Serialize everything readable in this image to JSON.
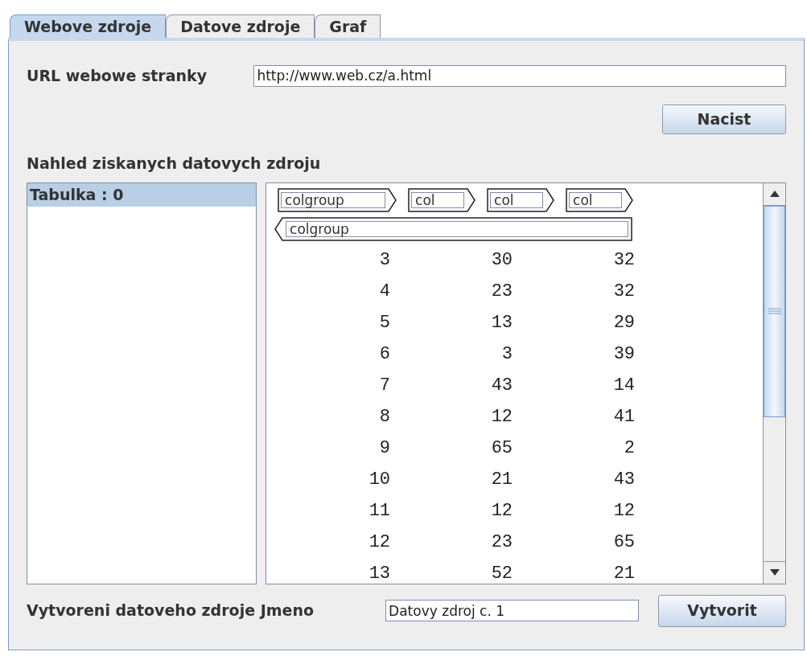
{
  "tabs": [
    {
      "label": "Webove zdroje",
      "selected": true
    },
    {
      "label": "Datove zdroje",
      "selected": false
    },
    {
      "label": "Graf",
      "selected": false
    }
  ],
  "url": {
    "label": "URL webowe stranky",
    "value": "http://www.web.cz/a.html"
  },
  "load_button": "Nacist",
  "preview_heading": "Nahled ziskanych datovych zdroju",
  "tables": [
    {
      "label": "Tabulka : 0",
      "selected": true
    }
  ],
  "tags_row": [
    {
      "label": "colgroup",
      "kind": "open"
    },
    {
      "label": "col",
      "kind": "open"
    },
    {
      "label": "col",
      "kind": "open"
    },
    {
      "label": "col",
      "kind": "open"
    }
  ],
  "tags_row_2": [
    {
      "label": "colgroup",
      "kind": "close"
    }
  ],
  "rows": [
    [
      "3",
      "30",
      "32"
    ],
    [
      "4",
      "23",
      "32"
    ],
    [
      "5",
      "13",
      "29"
    ],
    [
      "6",
      "3",
      "39"
    ],
    [
      "7",
      "43",
      "14"
    ],
    [
      "8",
      "12",
      "41"
    ],
    [
      "9",
      "65",
      "2"
    ],
    [
      "10",
      "21",
      "43"
    ],
    [
      "11",
      "12",
      "12"
    ],
    [
      "12",
      "23",
      "65"
    ],
    [
      "13",
      "52",
      "21"
    ]
  ],
  "create": {
    "label": "Vytvoreni datoveho zdroje Jmeno",
    "value": "Datovy zdroj c. 1",
    "button": "Vytvorit"
  }
}
